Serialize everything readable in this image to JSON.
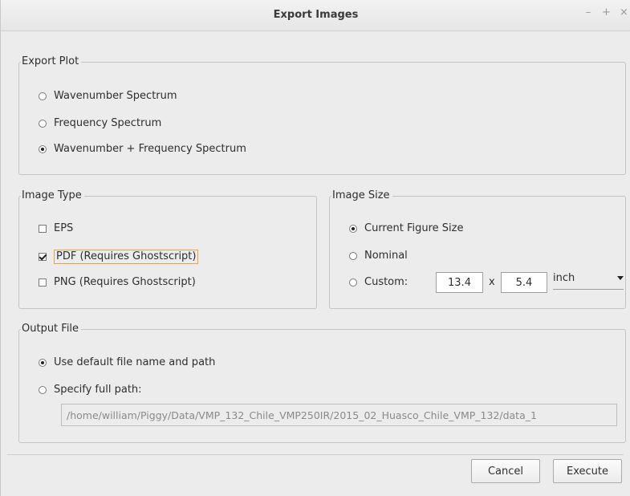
{
  "window": {
    "title": "Export Images",
    "controls": {
      "minimize": "–",
      "maximize": "+",
      "close": "×"
    }
  },
  "export_plot": {
    "legend": "Export Plot",
    "options": [
      {
        "label": "Wavenumber Spectrum",
        "selected": false
      },
      {
        "label": "Frequency Spectrum",
        "selected": false
      },
      {
        "label": "Wavenumber + Frequency Spectrum",
        "selected": true
      }
    ]
  },
  "image_type": {
    "legend": "Image Type",
    "options": [
      {
        "label": "EPS",
        "checked": false
      },
      {
        "label": "PDF (Requires Ghostscript)",
        "checked": true
      },
      {
        "label": "PNG (Requires Ghostscript)",
        "checked": false
      }
    ]
  },
  "image_size": {
    "legend": "Image Size",
    "options": [
      {
        "label": "Current Figure Size",
        "selected": true
      },
      {
        "label": "Nominal",
        "selected": false
      },
      {
        "label": "Custom:",
        "selected": false
      }
    ],
    "width": "13.4",
    "times": "x",
    "height": "5.4",
    "unit": "inch"
  },
  "output_file": {
    "legend": "Output File",
    "options": [
      {
        "label": "Use default file name and path",
        "selected": true
      },
      {
        "label": "Specify full path:",
        "selected": false
      }
    ],
    "path": "/home/william/Piggy/Data/VMP_132_Chile_VMP250IR/2015_02_Huasco_Chile_VMP_132/data_1"
  },
  "footer": {
    "cancel_label": "Cancel",
    "execute_label": "Execute"
  }
}
